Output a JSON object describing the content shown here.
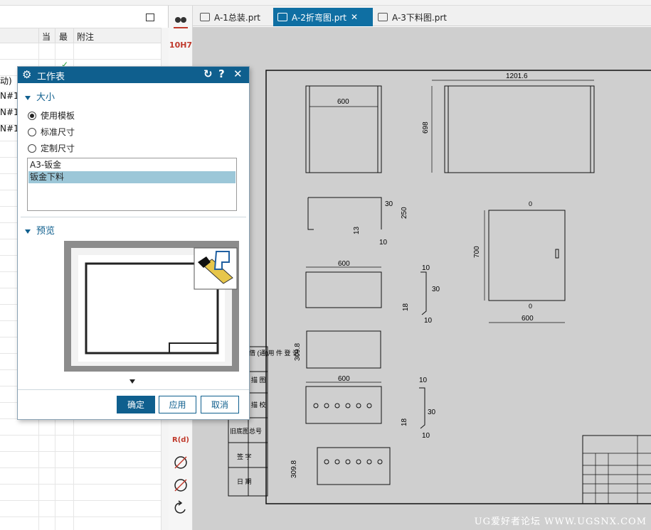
{
  "tabs": [
    {
      "label": "A-1总装.prt",
      "active": false
    },
    {
      "label": "A-2折弯图.prt",
      "active": true
    },
    {
      "label": "A-3下料图.prt",
      "active": false
    }
  ],
  "navigator": {
    "columns": [
      "当",
      "最",
      "附注"
    ],
    "row_texts": [
      "动)",
      "N#1",
      "N#1",
      "N#1"
    ]
  },
  "toolbar": {
    "dim_label": "10H7",
    "radius_label": "R(d)"
  },
  "dialog": {
    "title": "工作表",
    "size_section": "大小",
    "options": [
      "使用模板",
      "标准尺寸",
      "定制尺寸"
    ],
    "selected_option": "使用模板",
    "templates": [
      "A3-钣金",
      "钣金下料"
    ],
    "selected_template": "钣金下料",
    "preview_section": "预览",
    "buttons": {
      "ok": "确定",
      "apply": "应用",
      "cancel": "取消"
    }
  },
  "drawing": {
    "dims": {
      "top_width": "1201.6",
      "top_height": "698",
      "left_width": "600",
      "d30a": "30",
      "d250": "250",
      "d13a": "13",
      "d10a": "10",
      "mid_width": "600",
      "d10b": "10",
      "d30b": "30",
      "d18a": "18",
      "d10c": "10",
      "d3098a": "309.8",
      "third_width": "600",
      "d10d": "10",
      "d30c": "30",
      "d18b": "18",
      "d10e": "10",
      "d3098b": "309.8",
      "door_height": "700",
      "door_width": "600",
      "mark_zero_a": "0",
      "mark_zero_b": "0"
    },
    "title_rows": [
      "借 (通)用 件 登 记",
      "描 图",
      "描 校",
      "旧底图总号",
      "签 字",
      "日 期"
    ],
    "watermark": "UG爱好者论坛 WWW.UGSNX.COM"
  }
}
